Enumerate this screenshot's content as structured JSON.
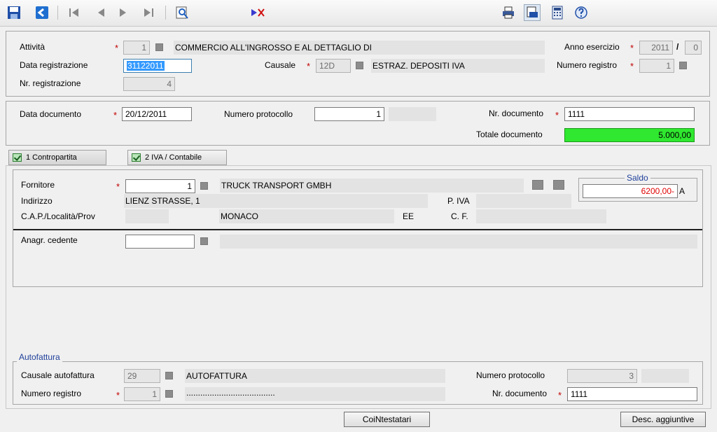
{
  "colors": {
    "accent_blue": "#1f5fbf",
    "required": "#c00000",
    "total_bg": "#2fe82f",
    "saldo_value": "#e00000"
  },
  "toolbar": {
    "save": "save-icon",
    "back": "back-icon",
    "first": "first-record-icon",
    "prev": "previous-record-icon",
    "next": "next-record-icon",
    "last": "last-record-icon",
    "search": "search-icon",
    "clear": "clear-filter-icon",
    "print": "print-icon",
    "preview": "print-preview-icon",
    "calc": "calculator-icon",
    "help": "help-icon"
  },
  "header": {
    "attivita_label": "Attività",
    "attivita_value": "1",
    "attivita_desc": "COMMERCIO ALL'INGROSSO E AL DETTAGLIO DI",
    "anno_label": "Anno esercizio",
    "anno_value": "2011",
    "anno_sep": "/",
    "anno_sub": "0",
    "data_reg_label": "Data registrazione",
    "data_reg_value": "31122011",
    "causale_label": "Causale",
    "causale_value": "12D",
    "causale_desc": "ESTRAZ. DEPOSITI IVA",
    "num_registro_label": "Numero registro",
    "num_registro_value": "1",
    "nr_reg_label": "Nr. registrazione",
    "nr_reg_value": "4"
  },
  "document": {
    "data_doc_label": "Data documento",
    "data_doc_value": "20/12/2011",
    "num_prot_label": "Numero protocollo",
    "num_prot_value": "1",
    "nr_doc_label": "Nr. documento",
    "nr_doc_value": "1111",
    "totale_label": "Totale documento",
    "totale_value": "5.000,00"
  },
  "tabs": [
    {
      "label": "1 Contropartita"
    },
    {
      "label": "2 IVA / Contabile"
    }
  ],
  "supplier": {
    "fornitore_label": "Fornitore",
    "fornitore_value": "1",
    "fornitore_name": "TRUCK TRANSPORT GMBH",
    "indirizzo_label": "Indirizzo",
    "indirizzo_value": "LIENZ STRASSE, 1",
    "piva_label": "P. IVA",
    "cap_label": "C.A.P./Località/Prov",
    "citta": "MONACO",
    "prov": "EE",
    "cf_label": "C. F.",
    "saldo_title": "Saldo",
    "saldo_value": "6200,00-",
    "saldo_suffix": "A",
    "anagr_label": "Anagr. cedente"
  },
  "autofattura": {
    "title": "Autofattura",
    "causale_label": "Causale autofattura",
    "causale_value": "29",
    "causale_desc": "AUTOFATTURA",
    "num_prot_label": "Numero protocollo",
    "num_prot_value": "3",
    "num_reg_label": "Numero registro",
    "num_reg_value": "1",
    "num_reg_desc": "......................................",
    "nr_doc_label": "Nr. documento",
    "nr_doc_value": "1111"
  },
  "buttons": {
    "cointestatari": "CoiNtestatari",
    "desc_aggiuntive": "Desc. aggiuntive"
  }
}
